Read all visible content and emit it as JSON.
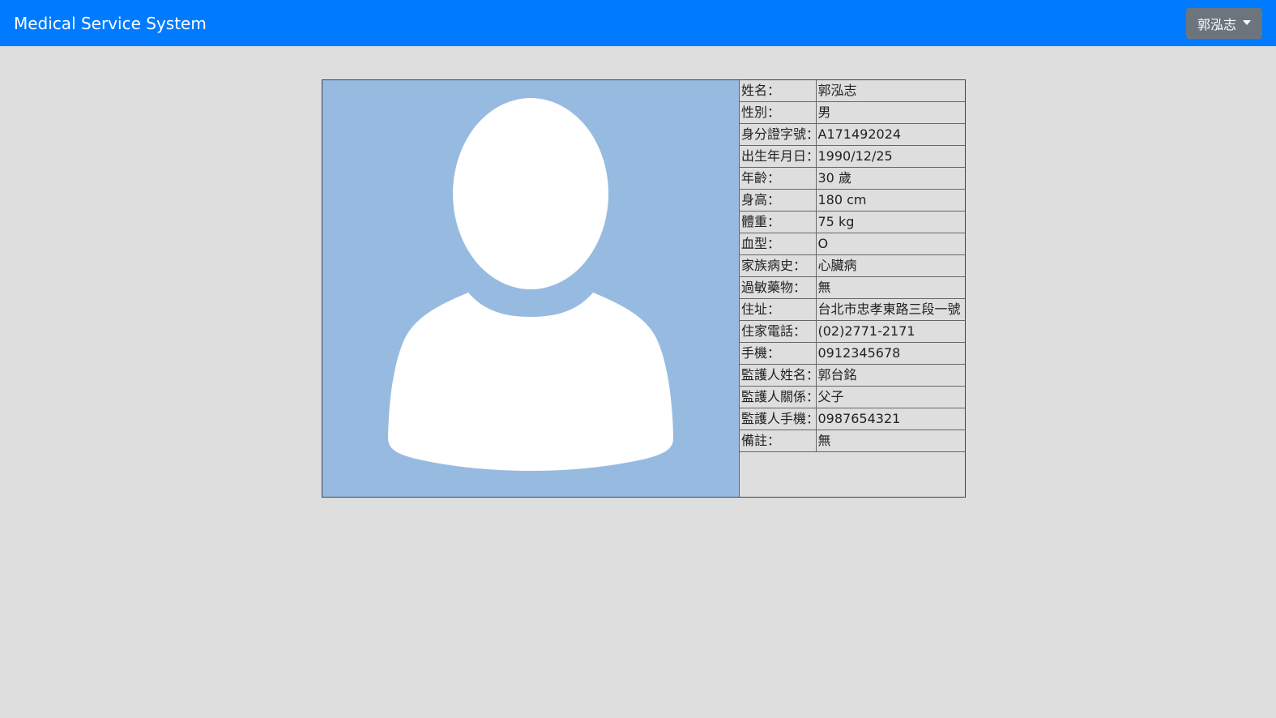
{
  "navbar": {
    "brand": "Medical Service System",
    "user_name": "郭泓志"
  },
  "profile": {
    "photo_icon": "user-silhouette-icon",
    "rows": [
      {
        "label": "姓名：",
        "value": "郭泓志"
      },
      {
        "label": "性別：",
        "value": "男"
      },
      {
        "label": "身分證字號：",
        "value": "A171492024"
      },
      {
        "label": "出生年月日：",
        "value": "1990/12/25"
      },
      {
        "label": "年齡：",
        "value": "30 歲"
      },
      {
        "label": "身高：",
        "value": "180 cm"
      },
      {
        "label": "體重：",
        "value": "75 kg"
      },
      {
        "label": "血型：",
        "value": "O"
      },
      {
        "label": "家族病史：",
        "value": "心臟病"
      },
      {
        "label": "過敏藥物：",
        "value": "無"
      },
      {
        "label": "住址：",
        "value": "台北市忠孝東路三段一號"
      },
      {
        "label": "住家電話：",
        "value": "(02)2771-2171"
      },
      {
        "label": "手機：",
        "value": "0912345678"
      },
      {
        "label": "監護人姓名：",
        "value": "郭台銘"
      },
      {
        "label": "監護人關係：",
        "value": "父子"
      },
      {
        "label": "監護人手機：",
        "value": "0987654321"
      },
      {
        "label": "備註：",
        "value": "無"
      }
    ]
  },
  "colors": {
    "navbar": "#007bff",
    "user_button": "#6c757d",
    "photo_background": "#97bbe0",
    "page_background": "#dedede"
  }
}
